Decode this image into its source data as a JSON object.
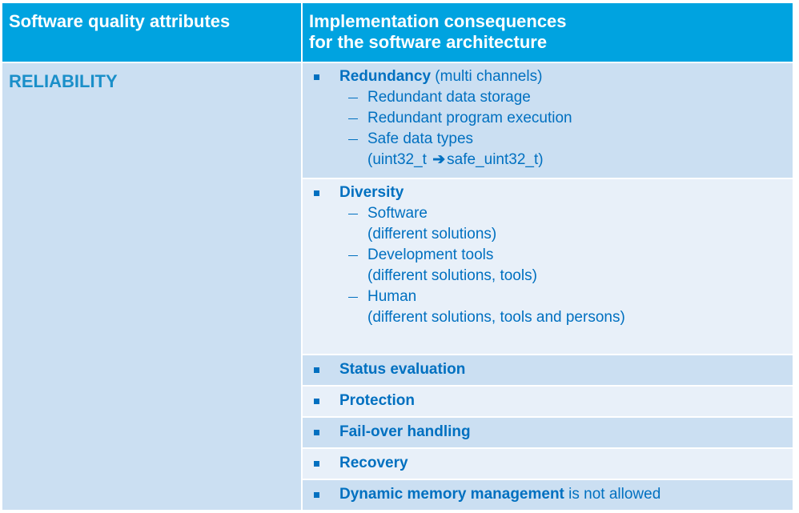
{
  "header": {
    "col1": "Software quality attributes",
    "col2_line1": "Implementation consequences",
    "col2_line2": "for the software architecture"
  },
  "attribute": "RELIABILITY",
  "colors": {
    "header_bg": "#00a3e0",
    "row_dark": "#cbdff2",
    "row_light": "#e8f0f9",
    "text_blue": "#0070c0"
  },
  "rows": [
    {
      "title": "Redundancy",
      "suffix": " (multi channels)",
      "sub": [
        "Redundant data storage",
        "Redundant program execution",
        "Safe data types"
      ],
      "safe_types": {
        "from": "(uint32_t ",
        "arrow": "arrow-right-icon",
        "to": "safe_uint32_t)"
      }
    },
    {
      "title": "Diversity",
      "sub": [
        {
          "label": "Software",
          "note": "(different solutions)"
        },
        {
          "label": "Development tools",
          "note": "(different solutions, tools)"
        },
        {
          "label": "Human",
          "note": "(different solutions, tools and persons)"
        }
      ]
    },
    {
      "title": "Status evaluation"
    },
    {
      "title": "Protection"
    },
    {
      "title": "Fail-over handling"
    },
    {
      "title": "Recovery"
    },
    {
      "title": "Dynamic memory management",
      "suffix": " is not allowed"
    }
  ]
}
